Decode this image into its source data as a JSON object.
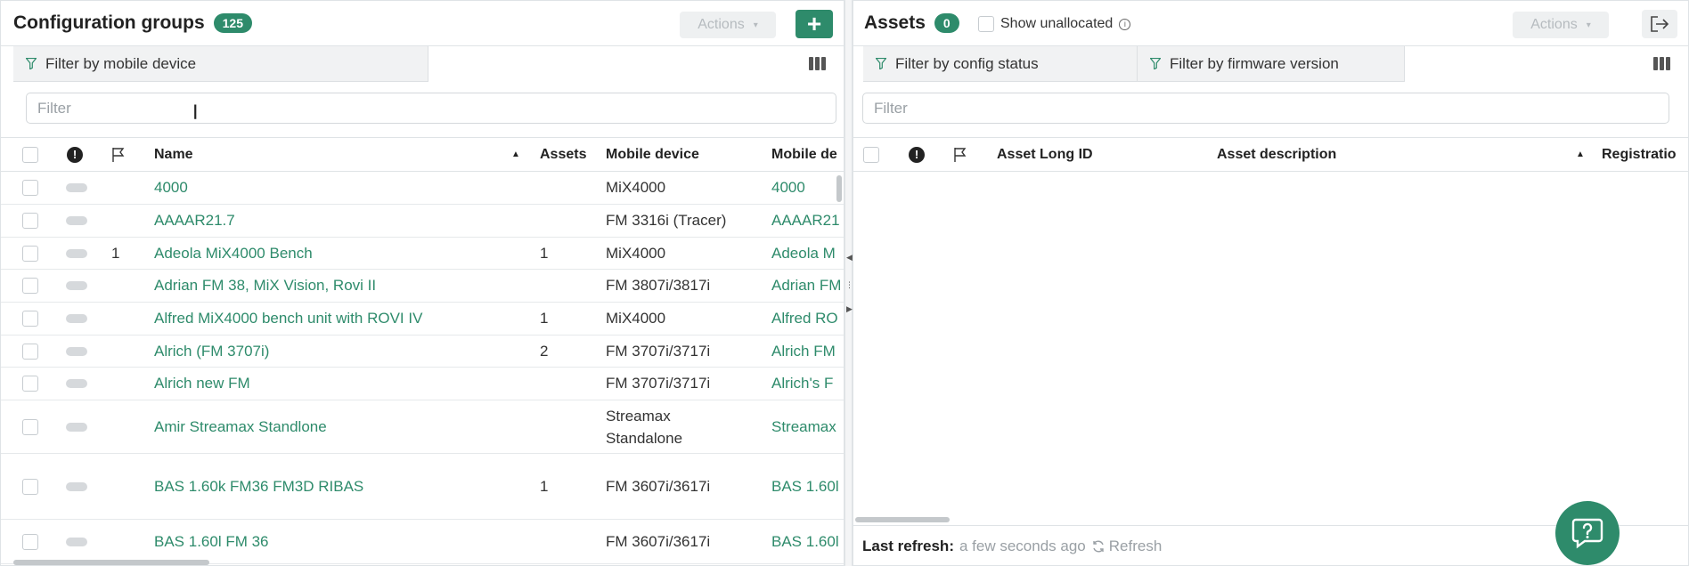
{
  "left": {
    "title": "Configuration groups",
    "count": "125",
    "actions_label": "Actions",
    "add_label": "+",
    "filter_chip": "Filter by mobile device",
    "search_placeholder": "Filter",
    "columns": {
      "name": "Name",
      "assets": "Assets",
      "mobile_device": "Mobile device",
      "mobile_de": "Mobile de"
    },
    "rows": [
      {
        "flag": "",
        "name": "4000",
        "assets": "",
        "device": "MiX4000",
        "device2": "",
        "mobile_de": "4000"
      },
      {
        "flag": "",
        "name": "AAAAR21.7",
        "assets": "",
        "device": "FM 3316i (Tracer)",
        "device2": "",
        "mobile_de": "AAAAR21"
      },
      {
        "flag": "1",
        "name": "Adeola MiX4000 Bench",
        "assets": "1",
        "device": "MiX4000",
        "device2": "",
        "mobile_de": "Adeola M"
      },
      {
        "flag": "",
        "name": "Adrian FM 38, MiX Vision, Rovi II",
        "assets": "",
        "device": "FM 3807i/3817i",
        "device2": "",
        "mobile_de": "Adrian FM"
      },
      {
        "flag": "",
        "name": "Alfred MiX4000 bench unit with ROVI IV",
        "assets": "1",
        "device": "MiX4000",
        "device2": "",
        "mobile_de": "Alfred RO"
      },
      {
        "flag": "",
        "name": "Alrich (FM 3707i)",
        "assets": "2",
        "device": "FM 3707i/3717i",
        "device2": "",
        "mobile_de": "Alrich FM"
      },
      {
        "flag": "",
        "name": "Alrich new FM",
        "assets": "",
        "device": "FM 3707i/3717i",
        "device2": "",
        "mobile_de": "Alrich's F"
      },
      {
        "flag": "",
        "name": "Amir Streamax Standlone",
        "assets": "",
        "device": "Streamax",
        "device2": "Standalone",
        "mobile_de": "Streamax"
      },
      {
        "flag": "",
        "name": "BAS 1.60k FM36 FM3D RIBAS",
        "assets": "1",
        "device": "FM 3607i/3617i",
        "device2": "",
        "mobile_de": "BAS 1.60l"
      },
      {
        "flag": "",
        "name": "BAS 1.60l FM 36",
        "assets": "",
        "device": "FM 3607i/3617i",
        "device2": "",
        "mobile_de": "BAS 1.60l"
      }
    ]
  },
  "right": {
    "title": "Assets",
    "count": "0",
    "show_unallocated": "Show unallocated",
    "actions_label": "Actions",
    "filter_chip_1": "Filter by config status",
    "filter_chip_2": "Filter by firmware version",
    "search_placeholder": "Filter",
    "columns": {
      "long_id": "Asset Long ID",
      "description": "Asset description",
      "registration": "Registratio"
    },
    "footer": {
      "label": "Last refresh:",
      "time": "a few seconds ago",
      "refresh": "Refresh"
    }
  },
  "icons": {
    "help": "chat-help-icon",
    "logout": "logout-icon",
    "columns": "columns-icon",
    "filter": "funnel-icon"
  },
  "colors": {
    "accent": "#2e8b6b"
  }
}
